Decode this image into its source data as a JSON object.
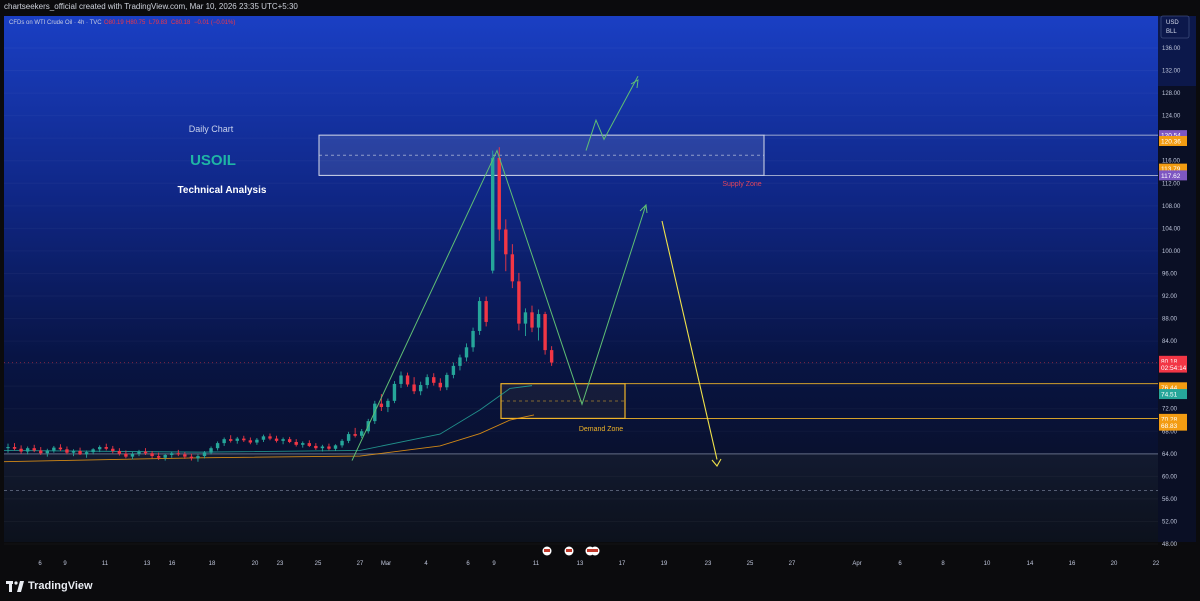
{
  "header": {
    "attribution": "chartseekers_official created with TradingView.com, Mar 10, 2026 23:35 UTC+5:30"
  },
  "legend": {
    "symbol": "CFDs on WTI Crude Oil · 4h · TVC",
    "open": "O80.19",
    "high": "H80.75",
    "low": "L79.83",
    "close": "C80.18",
    "change": "−0.01 (−0.01%)"
  },
  "currency": {
    "line1": "USD",
    "line2": "BLL"
  },
  "annotations": {
    "daily_chart": "Daily Chart",
    "symbol_title": "USOIL",
    "technical_analysis": "Technical Analysis",
    "supply_zone": "Supply Zone",
    "demand_zone": "Demand Zone"
  },
  "price_badges": [
    {
      "text": "120.54",
      "price": 120.54,
      "color": "#7e57c2"
    },
    {
      "text": "120.36",
      "price": 119.5,
      "color": "#f39c12"
    },
    {
      "text": "113.79",
      "price": 114.6,
      "color": "#f39c12"
    },
    {
      "text": "117.62",
      "price": 113.4,
      "color": "#7e57c2"
    },
    {
      "text": "80.18",
      "price": 80.5,
      "color": "#f23645"
    },
    {
      "text": "02:54:14",
      "price": 79.3,
      "color": "#f23645"
    },
    {
      "text": "76.44",
      "price": 75.8,
      "color": "#f39c12"
    },
    {
      "text": "74.51",
      "price": 74.6,
      "color": "#26a69a"
    },
    {
      "text": "70.28",
      "price": 70.2,
      "color": "#f39c12"
    },
    {
      "text": "68.83",
      "price": 69.0,
      "color": "#f39c12"
    }
  ],
  "footer": {
    "brand": "TradingView"
  },
  "chart_data": {
    "type": "candlestick",
    "title": "USOIL",
    "subtitle": "Daily Chart",
    "instrument": "CFDs on WTI Crude Oil",
    "interval": "4h",
    "ylim": [
      48,
      140
    ],
    "y_ticks": [
      136,
      132,
      128,
      124,
      120,
      116,
      112,
      108,
      104,
      100,
      96,
      92,
      88,
      84,
      80,
      76,
      72,
      68,
      64,
      60,
      56,
      52,
      48
    ],
    "x_ticks": [
      "6",
      "9",
      "11",
      "13",
      "16",
      "18",
      "20",
      "23",
      "25",
      "27",
      "Mar",
      "4",
      "6",
      "9",
      "11",
      "13",
      "17",
      "19",
      "23",
      "25",
      "27",
      "Apr",
      "6",
      "8",
      "10",
      "14",
      "16",
      "20",
      "22"
    ],
    "last_price": 80.18,
    "supply_zone": [
      113.4,
      120.54
    ],
    "demand_zone": [
      70.28,
      76.44
    ],
    "candles": [
      {
        "o": 65.0,
        "h": 65.8,
        "l": 64.2,
        "c": 65.2
      },
      {
        "o": 65.2,
        "h": 65.9,
        "l": 64.6,
        "c": 64.9
      },
      {
        "o": 64.9,
        "h": 65.5,
        "l": 64.0,
        "c": 64.4
      },
      {
        "o": 64.4,
        "h": 65.3,
        "l": 63.9,
        "c": 65.0
      },
      {
        "o": 65.0,
        "h": 65.6,
        "l": 64.3,
        "c": 64.6
      },
      {
        "o": 64.6,
        "h": 65.2,
        "l": 63.8,
        "c": 64.1
      },
      {
        "o": 64.1,
        "h": 64.9,
        "l": 63.5,
        "c": 64.6
      },
      {
        "o": 64.6,
        "h": 65.4,
        "l": 64.2,
        "c": 65.1
      },
      {
        "o": 65.1,
        "h": 65.7,
        "l": 64.5,
        "c": 64.8
      },
      {
        "o": 64.8,
        "h": 65.3,
        "l": 63.9,
        "c": 64.2
      },
      {
        "o": 64.2,
        "h": 64.8,
        "l": 63.6,
        "c": 64.5
      },
      {
        "o": 64.5,
        "h": 65.1,
        "l": 63.8,
        "c": 63.9
      },
      {
        "o": 63.9,
        "h": 64.6,
        "l": 63.3,
        "c": 64.3
      },
      {
        "o": 64.3,
        "h": 65.0,
        "l": 63.9,
        "c": 64.8
      },
      {
        "o": 64.8,
        "h": 65.5,
        "l": 64.3,
        "c": 65.2
      },
      {
        "o": 65.2,
        "h": 65.8,
        "l": 64.6,
        "c": 64.9
      },
      {
        "o": 64.9,
        "h": 65.4,
        "l": 64.1,
        "c": 64.5
      },
      {
        "o": 64.5,
        "h": 65.0,
        "l": 63.7,
        "c": 64.0
      },
      {
        "o": 64.0,
        "h": 64.6,
        "l": 63.2,
        "c": 63.5
      },
      {
        "o": 63.5,
        "h": 64.3,
        "l": 63.0,
        "c": 64.0
      },
      {
        "o": 64.0,
        "h": 64.7,
        "l": 63.6,
        "c": 64.4
      },
      {
        "o": 64.4,
        "h": 65.0,
        "l": 63.8,
        "c": 64.1
      },
      {
        "o": 64.1,
        "h": 64.5,
        "l": 63.2,
        "c": 63.6
      },
      {
        "o": 63.6,
        "h": 64.2,
        "l": 62.9,
        "c": 63.3
      },
      {
        "o": 63.3,
        "h": 64.0,
        "l": 62.8,
        "c": 63.8
      },
      {
        "o": 63.8,
        "h": 64.4,
        "l": 63.3,
        "c": 64.1
      },
      {
        "o": 64.1,
        "h": 64.7,
        "l": 63.6,
        "c": 63.9
      },
      {
        "o": 63.9,
        "h": 64.3,
        "l": 63.1,
        "c": 63.5
      },
      {
        "o": 63.5,
        "h": 64.0,
        "l": 62.8,
        "c": 63.2
      },
      {
        "o": 63.2,
        "h": 63.9,
        "l": 62.6,
        "c": 63.6
      },
      {
        "o": 63.6,
        "h": 64.5,
        "l": 63.2,
        "c": 64.2
      },
      {
        "o": 64.2,
        "h": 65.3,
        "l": 63.9,
        "c": 65.0
      },
      {
        "o": 65.0,
        "h": 66.2,
        "l": 64.6,
        "c": 65.9
      },
      {
        "o": 65.9,
        "h": 66.9,
        "l": 65.4,
        "c": 66.6
      },
      {
        "o": 66.6,
        "h": 67.3,
        "l": 66.0,
        "c": 66.3
      },
      {
        "o": 66.3,
        "h": 67.0,
        "l": 65.8,
        "c": 66.7
      },
      {
        "o": 66.7,
        "h": 67.2,
        "l": 66.1,
        "c": 66.4
      },
      {
        "o": 66.4,
        "h": 66.9,
        "l": 65.7,
        "c": 66.0
      },
      {
        "o": 66.0,
        "h": 66.8,
        "l": 65.6,
        "c": 66.5
      },
      {
        "o": 66.5,
        "h": 67.4,
        "l": 66.1,
        "c": 67.1
      },
      {
        "o": 67.1,
        "h": 67.6,
        "l": 66.4,
        "c": 66.7
      },
      {
        "o": 66.7,
        "h": 67.2,
        "l": 66.0,
        "c": 66.3
      },
      {
        "o": 66.3,
        "h": 66.9,
        "l": 65.7,
        "c": 66.6
      },
      {
        "o": 66.6,
        "h": 67.0,
        "l": 65.9,
        "c": 66.1
      },
      {
        "o": 66.1,
        "h": 66.6,
        "l": 65.3,
        "c": 65.6
      },
      {
        "o": 65.6,
        "h": 66.2,
        "l": 65.1,
        "c": 65.9
      },
      {
        "o": 65.9,
        "h": 66.4,
        "l": 65.2,
        "c": 65.4
      },
      {
        "o": 65.4,
        "h": 65.9,
        "l": 64.7,
        "c": 65.0
      },
      {
        "o": 65.0,
        "h": 65.6,
        "l": 64.4,
        "c": 65.3
      },
      {
        "o": 65.3,
        "h": 65.8,
        "l": 64.6,
        "c": 64.9
      },
      {
        "o": 64.9,
        "h": 65.7,
        "l": 64.5,
        "c": 65.5
      },
      {
        "o": 65.5,
        "h": 66.6,
        "l": 65.1,
        "c": 66.3
      },
      {
        "o": 66.3,
        "h": 67.9,
        "l": 65.9,
        "c": 67.5
      },
      {
        "o": 67.5,
        "h": 68.6,
        "l": 66.9,
        "c": 67.2
      },
      {
        "o": 67.2,
        "h": 68.4,
        "l": 66.8,
        "c": 68.0
      },
      {
        "o": 68.0,
        "h": 70.2,
        "l": 67.6,
        "c": 69.8
      },
      {
        "o": 69.8,
        "h": 73.4,
        "l": 69.3,
        "c": 72.9
      },
      {
        "o": 72.9,
        "h": 74.6,
        "l": 71.6,
        "c": 72.3
      },
      {
        "o": 72.3,
        "h": 73.8,
        "l": 71.4,
        "c": 73.4
      },
      {
        "o": 73.4,
        "h": 76.9,
        "l": 73.0,
        "c": 76.4
      },
      {
        "o": 76.4,
        "h": 78.6,
        "l": 75.7,
        "c": 77.9
      },
      {
        "o": 77.9,
        "h": 78.4,
        "l": 75.9,
        "c": 76.3
      },
      {
        "o": 76.3,
        "h": 77.6,
        "l": 74.6,
        "c": 75.1
      },
      {
        "o": 75.1,
        "h": 76.8,
        "l": 74.4,
        "c": 76.2
      },
      {
        "o": 76.2,
        "h": 78.1,
        "l": 75.6,
        "c": 77.6
      },
      {
        "o": 77.6,
        "h": 78.3,
        "l": 76.1,
        "c": 76.6
      },
      {
        "o": 76.6,
        "h": 77.4,
        "l": 75.2,
        "c": 75.8
      },
      {
        "o": 75.8,
        "h": 78.4,
        "l": 75.3,
        "c": 78.0
      },
      {
        "o": 78.0,
        "h": 80.2,
        "l": 77.4,
        "c": 79.6
      },
      {
        "o": 79.6,
        "h": 81.6,
        "l": 78.8,
        "c": 81.1
      },
      {
        "o": 81.1,
        "h": 83.6,
        "l": 80.4,
        "c": 82.9
      },
      {
        "o": 82.9,
        "h": 86.4,
        "l": 82.1,
        "c": 85.8
      },
      {
        "o": 85.8,
        "h": 91.8,
        "l": 85.1,
        "c": 91.1
      },
      {
        "o": 91.1,
        "h": 91.9,
        "l": 86.6,
        "c": 87.4
      },
      {
        "o": 96.5,
        "h": 117.8,
        "l": 96.0,
        "c": 116.5
      },
      {
        "o": 116.5,
        "h": 118.4,
        "l": 101.8,
        "c": 103.8
      },
      {
        "o": 103.8,
        "h": 105.6,
        "l": 96.4,
        "c": 99.4
      },
      {
        "o": 99.4,
        "h": 101.2,
        "l": 93.4,
        "c": 94.6
      },
      {
        "o": 94.6,
        "h": 96.1,
        "l": 85.9,
        "c": 87.1
      },
      {
        "o": 87.1,
        "h": 89.8,
        "l": 84.9,
        "c": 89.1
      },
      {
        "o": 89.1,
        "h": 90.3,
        "l": 85.6,
        "c": 86.4
      },
      {
        "o": 86.4,
        "h": 89.6,
        "l": 84.1,
        "c": 88.8
      },
      {
        "o": 88.8,
        "h": 89.2,
        "l": 81.6,
        "c": 82.4
      },
      {
        "o": 82.4,
        "h": 83.1,
        "l": 79.6,
        "c": 80.2
      }
    ],
    "ema_fast": [
      [
        0,
        64.6
      ],
      [
        30,
        64.3
      ],
      [
        56,
        67.5
      ],
      [
        64,
        71.8
      ],
      [
        72,
        75.6
      ],
      [
        78,
        76.1
      ]
    ],
    "ema_slow": [
      [
        0,
        62.6
      ],
      [
        30,
        63.3
      ],
      [
        56,
        65.4
      ],
      [
        64,
        67.6
      ],
      [
        72,
        70.0
      ],
      [
        78,
        70.9
      ]
    ],
    "projection_green": [
      [
        0,
        64.6
      ],
      [
        30,
        64.3
      ],
      [
        56,
        67.5
      ],
      [
        64,
        71.8
      ],
      [
        72,
        75.6
      ],
      [
        78,
        76.1
      ]
    ],
    "projection_yellow": [
      [
        0,
        62.6
      ],
      [
        30,
        63.3
      ],
      [
        56,
        65.4
      ],
      [
        64,
        67.6
      ],
      [
        72,
        70.0
      ],
      [
        78,
        70.9
      ]
    ]
  }
}
